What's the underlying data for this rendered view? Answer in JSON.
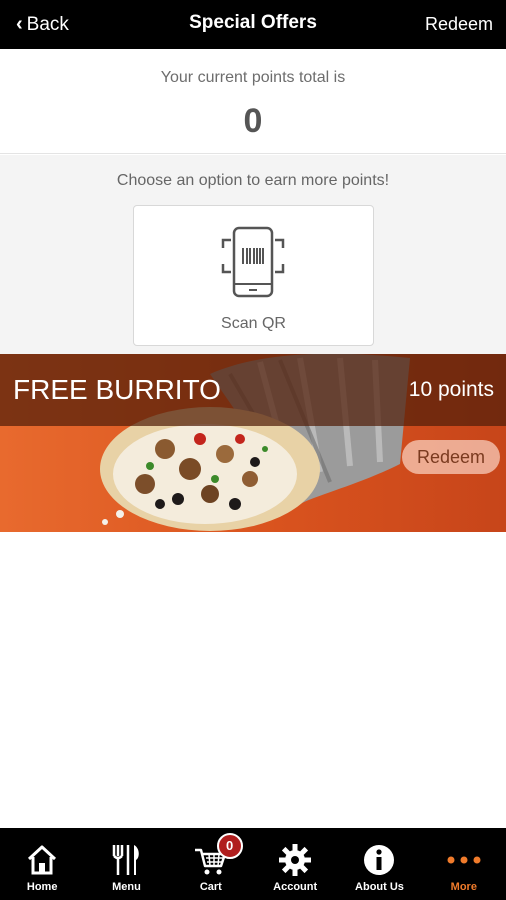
{
  "header": {
    "back_label": "Back",
    "title": "Special Offers",
    "redeem_label": "Redeem"
  },
  "points": {
    "label": "Your current points total is",
    "value": "0"
  },
  "earn": {
    "label": "Choose an option to earn more points!",
    "options": [
      {
        "label": "Scan QR",
        "icon": "qr-scan-phone-icon"
      }
    ]
  },
  "offers": [
    {
      "title": "FREE BURRITO",
      "points": "10 points",
      "redeem_label": "Redeem",
      "image": "burrito-image"
    }
  ],
  "tabbar": {
    "items": [
      {
        "label": "Home",
        "icon": "home-icon"
      },
      {
        "label": "Menu",
        "icon": "utensils-icon"
      },
      {
        "label": "Cart",
        "icon": "cart-icon",
        "badge": "0"
      },
      {
        "label": "Account",
        "icon": "gear-icon"
      },
      {
        "label": "About Us",
        "icon": "info-icon"
      },
      {
        "label": "More",
        "icon": "more-dots-icon",
        "active": true
      }
    ]
  },
  "colors": {
    "header_bg": "#000000",
    "accent_orange": "#f07b2b",
    "badge_red": "#b01e1e",
    "offer_band": "#521e0a"
  }
}
